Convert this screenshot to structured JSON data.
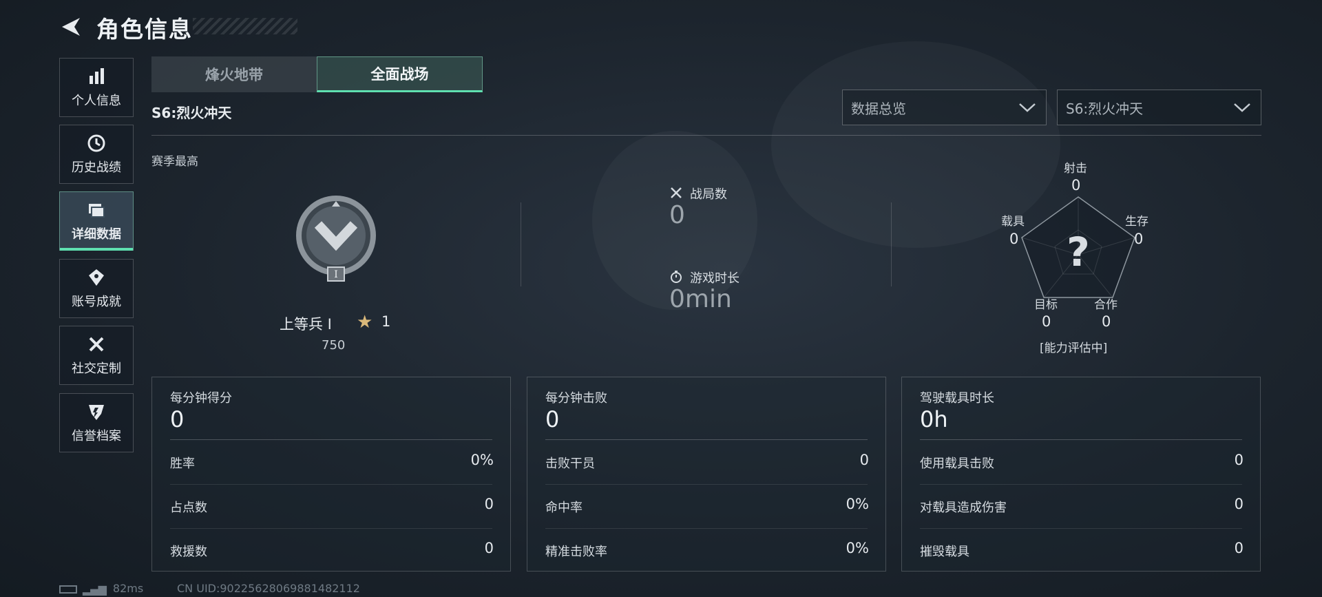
{
  "header": {
    "title": "角色信息"
  },
  "sidebar": {
    "items": [
      {
        "label": "个人信息",
        "icon": "bar-chart-icon"
      },
      {
        "label": "历史战绩",
        "icon": "history-icon"
      },
      {
        "label": "详细数据",
        "icon": "folder-icon",
        "active": true
      },
      {
        "label": "账号成就",
        "icon": "achievement-icon"
      },
      {
        "label": "社交定制",
        "icon": "tools-icon"
      },
      {
        "label": "信誉档案",
        "icon": "shield-icon"
      }
    ]
  },
  "tabs": [
    {
      "label": "烽火地带",
      "active": false
    },
    {
      "label": "全面战场",
      "active": true
    }
  ],
  "season_subtitle": "S6:烈火冲天",
  "filters": {
    "category": "数据总览",
    "season": "S6:烈火冲天"
  },
  "season_best": {
    "label": "赛季最高",
    "rank_name": "上等兵 I",
    "stars": "1",
    "points": "750",
    "badge_roman": "I"
  },
  "summary": {
    "matches_label": "战局数",
    "matches_value": "0",
    "playtime_label": "游戏时长",
    "playtime_value": "0min"
  },
  "radar": {
    "shoot": {
      "label": "射击",
      "value": "0"
    },
    "survive": {
      "label": "生存",
      "value": "0"
    },
    "cooperate": {
      "label": "合作",
      "value": "0"
    },
    "objective": {
      "label": "目标",
      "value": "0"
    },
    "vehicle": {
      "label": "载具",
      "value": "0"
    },
    "center_symbol": "?",
    "note": "[能力评估中]"
  },
  "panels": [
    {
      "title": "每分钟得分",
      "value": "0",
      "rows": [
        {
          "label": "胜率",
          "value": "0%"
        },
        {
          "label": "占点数",
          "value": "0"
        },
        {
          "label": "救援数",
          "value": "0"
        }
      ]
    },
    {
      "title": "每分钟击败",
      "value": "0",
      "rows": [
        {
          "label": "击败干员",
          "value": "0"
        },
        {
          "label": "命中率",
          "value": "0%"
        },
        {
          "label": "精准击败率",
          "value": "0%"
        }
      ]
    },
    {
      "title": "驾驶载具时长",
      "value": "0h",
      "rows": [
        {
          "label": "使用载具击败",
          "value": "0"
        },
        {
          "label": "对载具造成伤害",
          "value": "0"
        },
        {
          "label": "摧毁载具",
          "value": "0"
        }
      ]
    }
  ],
  "footer": {
    "ping": "82ms",
    "uid": "CN UID:90225628069881482112"
  },
  "colors": {
    "accent": "#5fe0b0",
    "star": "#d9b87a"
  }
}
